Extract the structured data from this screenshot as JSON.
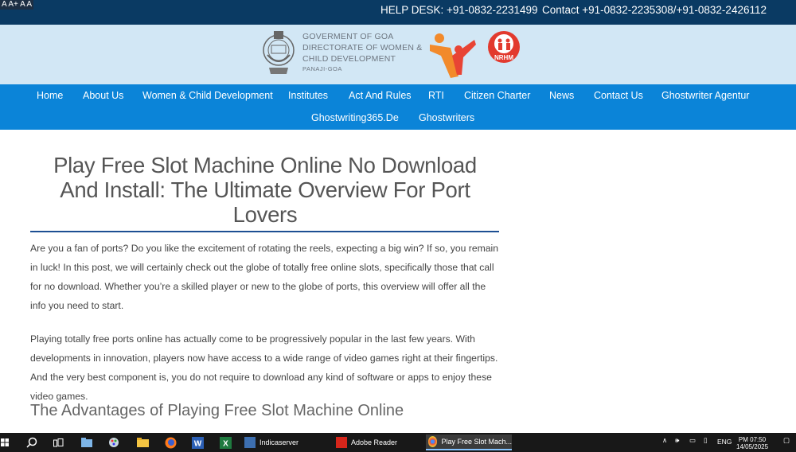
{
  "top": {
    "font_sizes": "A A+ A A",
    "helpdesk": "HELP DESK: +91-0832-2231499",
    "contact": "Contact +91-0832-2235308/+91-0832-2426112"
  },
  "header": {
    "line1": "GOVERMENT OF GOA",
    "line2": "DIRECTORATE OF WOMEN &",
    "line3": "CHILD DEVELOPMENT",
    "line4": "PANAJI-GOA",
    "nrhm": "NRHM"
  },
  "nav": {
    "items": [
      "Home",
      "About Us",
      "Women & Child Development",
      "Institutes",
      "Act And Rules",
      "RTI",
      "Citizen Charter",
      "News",
      "Contact Us",
      "Ghostwriter Agentur",
      "Ghostwriting365.De",
      "Ghostwriters"
    ]
  },
  "article": {
    "title": "Play Free Slot Machine Online No Download And Install: The Ultimate Overview For Port Lovers",
    "p1": "Are you a fan of ports? Do you like the excitement of rotating the reels, expecting a big win? If so, you remain in luck! In this post, we will certainly check out the globe of totally free online slots, specifically those that call for no download. Whether you’re a skilled player or new to the globe of ports, this overview will offer all the info you need to start.",
    "p2": "Playing totally free ports online has actually come to be progressively popular in the last few years. With devel­opments in innovation, players now have access to a wide range of video games right at their fingertips. And the very best component is, you do not require to download any kind of software or apps to enjoy these video games.",
    "h2": "The Advantages of Playing Free Slot Machine Online"
  },
  "taskbar": {
    "app1": "Indicaserver",
    "app2": "Adobe Reader",
    "app3": "Play Free Slot Mach...",
    "lang": "ENG",
    "time": "PM 07:50",
    "date": "14/05/2025"
  },
  "icons": {
    "start": "windows-start-icon",
    "search": "search-icon",
    "task_view": "task-view-icon"
  },
  "colors": {
    "topbar": "#0a3a63",
    "header": "#d2e7f5",
    "nav": "#0b84d8",
    "rule": "#1d4f93"
  }
}
